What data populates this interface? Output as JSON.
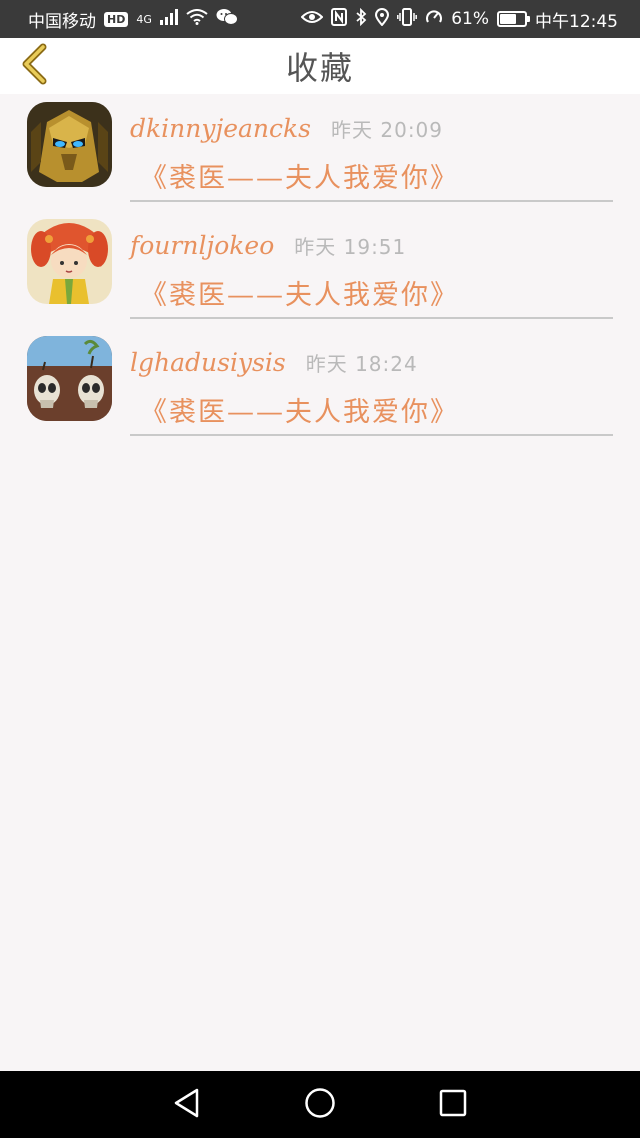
{
  "status_bar": {
    "carrier": "中国移动",
    "hd_badge": "HD",
    "network": "4G",
    "battery_percent": "61%",
    "battery_level": 0.61,
    "time": "中午12:45"
  },
  "header": {
    "title": "收藏"
  },
  "favorites": [
    {
      "username": "dkinnyjeancks",
      "timestamp": "昨天 20:09",
      "title": "《裘医——夫人我爱你》"
    },
    {
      "username": "fournljokeo",
      "timestamp": "昨天 19:51",
      "title": "《裘医——夫人我爱你》"
    },
    {
      "username": "lghadusiysis",
      "timestamp": "昨天 18:24",
      "title": "《裘医——夫人我爱你》"
    }
  ],
  "colors": {
    "accent": "#e8915e",
    "back_arrow": "#c8a33a",
    "background": "#f8f5f6"
  }
}
